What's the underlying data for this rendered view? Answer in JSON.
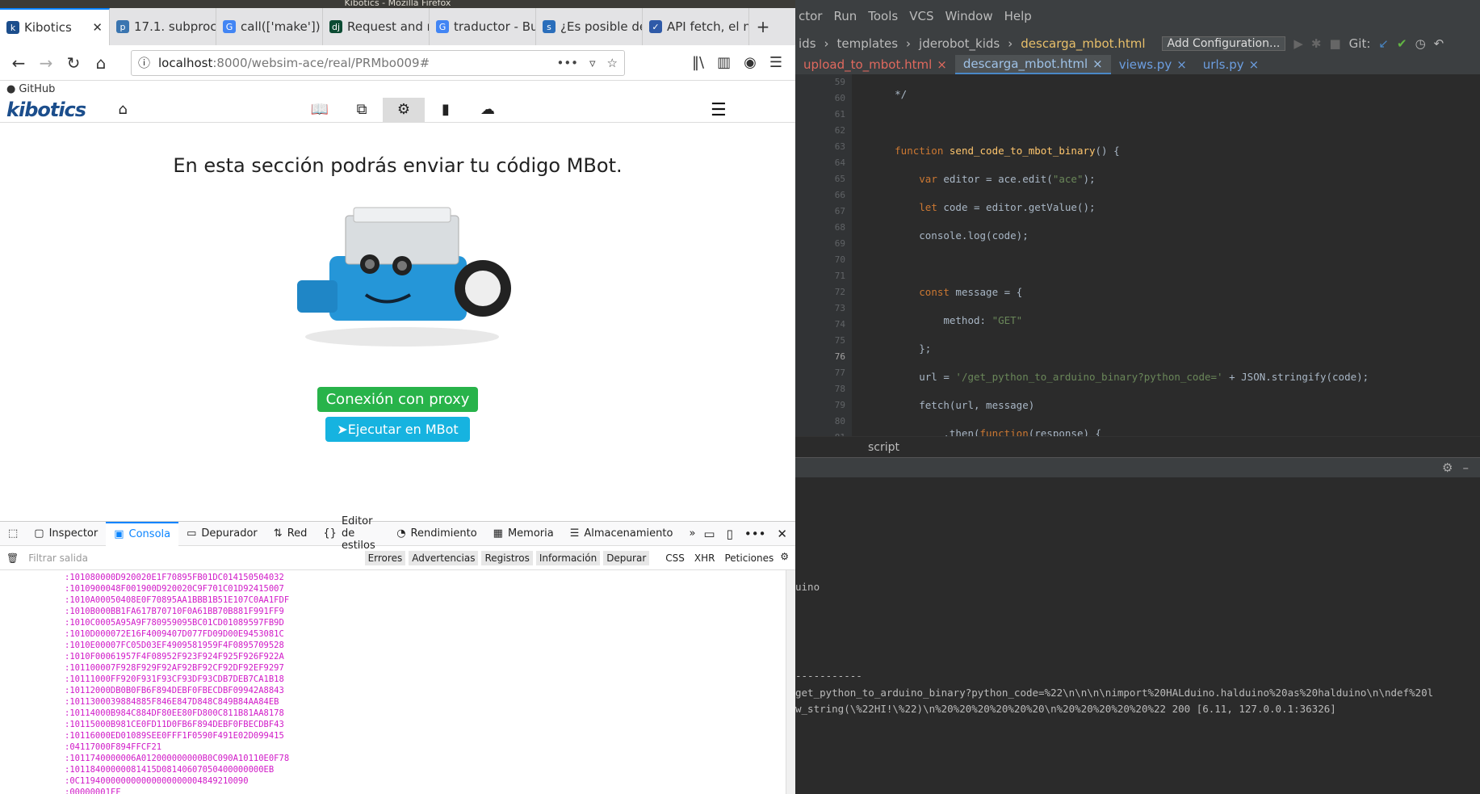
{
  "firefox": {
    "window_title": "Kibotics - Mozilla Firefox",
    "tabs": [
      {
        "label": "Kibotics",
        "icon": "kibotics-icon",
        "color": "#1c4e8c"
      },
      {
        "label": "17.1. subproce",
        "icon": "python-icon",
        "color": "#3a75b0"
      },
      {
        "label": "call(['make']) e",
        "icon": "google-icon",
        "color": "#4285f4"
      },
      {
        "label": "Request and r",
        "icon": "django-icon",
        "color": "#0c4b33"
      },
      {
        "label": "traductor - Bu",
        "icon": "google-icon",
        "color": "#4285f4"
      },
      {
        "label": "¿Es posible de",
        "icon": "stackoverflow-icon",
        "color": "#2a6ebb"
      },
      {
        "label": "API fetch, el n",
        "icon": "check-icon",
        "color": "#2f5aa8"
      }
    ],
    "url_host": "localhost",
    "url_path": ":8000/websim-ace/real/PRMbo009#",
    "bookmark": "GitHub",
    "site": {
      "logo": "kibotics",
      "heading": "En esta sección podrás enviar tu código MBot.",
      "btn_proxy": "Conexión con proxy",
      "btn_run": "Ejecutar en MBot"
    },
    "devtools": {
      "tabs": [
        "Inspector",
        "Consola",
        "Depurador",
        "Red",
        "Editor de estilos",
        "Rendimiento",
        "Memoria",
        "Almacenamiento"
      ],
      "filter_placeholder": "Filtrar salida",
      "filters": [
        "Errores",
        "Advertencias",
        "Registros",
        "Información",
        "Depurar",
        "CSS",
        "XHR",
        "Peticiones"
      ],
      "log": [
        ":101080000D920020E1F70895FB01DC014150504032",
        ":1010900048F001900D920020C9F701C01D92415007",
        ":1010A00050408E0F70895AA1BBB1B51E107C0AA1FDF",
        ":1010B000BB1FA617B70710F0A61BB70B881F991FF9",
        ":1010C0005A95A9F780959095BC01CD01089597FB9D",
        ":1010D000072E16F4009407D077FD09D00E9453081C",
        ":1010E00007FC05D03EF4909581959F4F0895709528",
        ":1010F00061957F4F08952F923F924F925F926F922A",
        ":101100007F928F929F92AF92BF92CF92DF92EF9297",
        ":10111000FF920F931F93CF93DF93CDB7DEB7CA1B18",
        ":10112000DB0B0FB6F894DEBF0FBECDBF09942A8843",
        ":1011300039884885F846E847D848C849B84AA84EB",
        ":10114000B984C884DF80EE80FD800C811B81AA8178",
        ":10115000B981CE0FD11D0FB6F894DEBF0FBECDBF43",
        ":10116000ED01089SEE0FFF1F0590F491E02D099415",
        ":04117000F894FFCF21",
        ":1011740000006A012000000000B0C090A10110E0F78",
        ":10118400000081415D08140607050400000000EB",
        ":0C119400000000000000000004849210090",
        ":00000001FF"
      ]
    }
  },
  "ide": {
    "menu": [
      "ctor",
      "Run",
      "Tools",
      "VCS",
      "Window",
      "Help"
    ],
    "path": [
      "ids",
      "templates",
      "jderobot_kids",
      "descarga_mbot.html"
    ],
    "add_config": "Add Configuration...",
    "git_label": "Git:",
    "tabs": [
      {
        "label": "upload_to_mbot.html",
        "style": "red"
      },
      {
        "label": "descarga_mbot.html",
        "style": "active"
      },
      {
        "label": "views.py",
        "style": "blue"
      },
      {
        "label": "urls.py",
        "style": "blue"
      }
    ],
    "line_numbers": [
      "59",
      "60",
      "61",
      "62",
      "63",
      "64",
      "65",
      "66",
      "67",
      "68",
      "69",
      "70",
      "71",
      "72",
      "73",
      "74",
      "75",
      "76",
      "77",
      "78",
      "79",
      "80",
      "81"
    ],
    "current_line": "76",
    "breadcrumb": "script",
    "output": [
      "uino",
      "-----------",
      "get_python_to_arduino_binary?python_code=%22\\n\\n\\n\\nimport%20HALduino.halduino%20as%20halduino\\n\\ndef%20l",
      "w_string(\\%22HI!\\%22)\\n%20%20%20%20%20%20\\n%20%20%20%20%20%22 200 [6.11, 127.0.0.1:36326]"
    ]
  }
}
